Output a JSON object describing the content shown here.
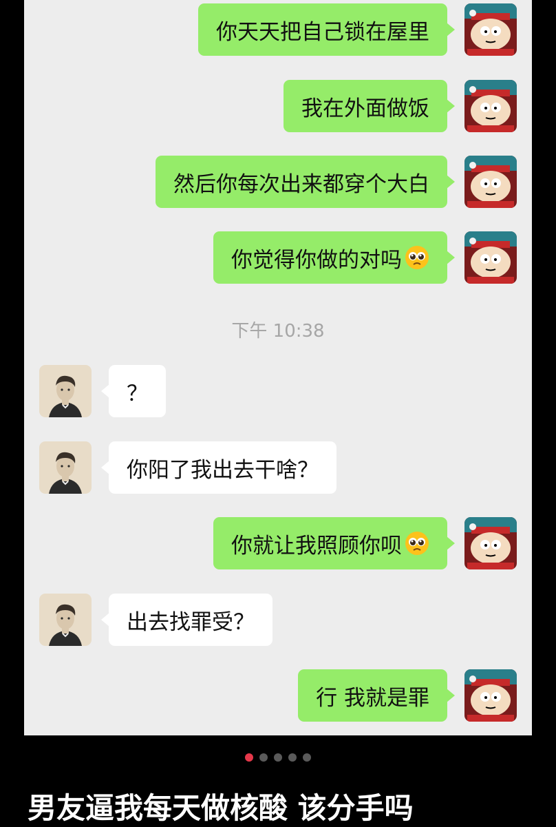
{
  "messages": [
    {
      "sender": "me",
      "text": "你天天把自己锁在屋里"
    },
    {
      "sender": "me",
      "text": "我在外面做饭"
    },
    {
      "sender": "me",
      "text": "然后你每次出来都穿个大白"
    },
    {
      "sender": "me",
      "text": "你觉得你做的对吗",
      "emoji": "pleading-face-icon"
    },
    {
      "sender": "them",
      "text": "？"
    },
    {
      "sender": "them",
      "text": "你阳了我出去干啥？"
    },
    {
      "sender": "me",
      "text": "你就让我照顾你呗",
      "emoji": "pleading-face-icon"
    },
    {
      "sender": "them",
      "text": "出去找罪受？"
    },
    {
      "sender": "me",
      "text": "行 我就是罪"
    }
  ],
  "timestamp": "下午 10:38",
  "carousel": {
    "total": 5,
    "active_index": 0
  },
  "post_title": "男友逼我每天做核酸 该分手吗",
  "colors": {
    "my_bubble": "#95ec69",
    "their_bubble": "#ffffff",
    "chat_background": "#ededed",
    "active_dot": "#e5384a"
  }
}
